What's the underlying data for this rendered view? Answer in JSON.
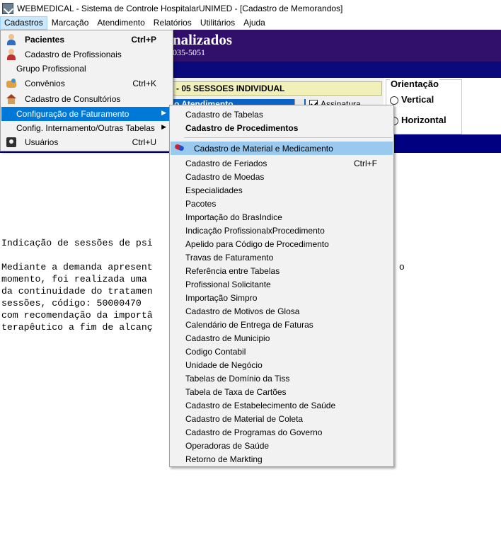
{
  "window": {
    "title": "WEBMEDICAL - Sistema de Controle HospitalarUNIMED - [Cadastro de Memorandos]"
  },
  "menubar": {
    "items": [
      "Cadastros",
      "Marcação",
      "Atendimento",
      "Relatórios",
      "Utilitários",
      "Ajuda"
    ]
  },
  "background": {
    "header_title": "nalizados",
    "header_phone": "035-5051",
    "sessions_field": "- 05 SESSOES INDIVIDUAL",
    "combo_value": "o Atendimento",
    "checkbox_label": "Assinatura",
    "orientation": {
      "title": "Orientação",
      "options": [
        "Vertical",
        "Horizontal"
      ]
    },
    "memo_lines": [
      "Indicação de sessões de psi",
      "Mediante a demanda apresent                              coterapia até o",
      "momento, foi realizada uma                             o a necessidade",
      "da continuidade do tratamen                             o de 5 (cinco)",
      "sessões, código: 50000470                              OR PSICOLOGO)",
      "com recomendação da importâ                           acompanhamento",
      "terapêutico a fim de alcanç"
    ]
  },
  "cadastros_menu": {
    "items": [
      {
        "label": "Pacientes",
        "shortcut": "Ctrl+P",
        "icon": "patient-icon"
      },
      {
        "label": "Cadastro de Profissionais",
        "shortcut": "",
        "icon": "doctor-icon"
      },
      {
        "label": "Grupo Profissional",
        "shortcut": ""
      },
      {
        "label": "Convênios",
        "shortcut": "Ctrl+K",
        "icon": "handshake-icon"
      },
      {
        "label": "Cadastro de Consultórios",
        "shortcut": "",
        "icon": "office-icon"
      },
      {
        "label": "Configuração de Faturamento",
        "shortcut": "",
        "submenu": true
      },
      {
        "label": "Config. Internamento/Outras Tabelas",
        "shortcut": "",
        "submenu": true
      },
      {
        "label": "Usuários",
        "shortcut": "Ctrl+U",
        "icon": "users-icon"
      }
    ]
  },
  "faturamento_submenu": {
    "items": [
      {
        "label": "Cadastro de Tabelas"
      },
      {
        "label": "Cadastro de Procedimentos"
      },
      {
        "label": "Cadastro de Material e Medicamento",
        "icon": "pill-icon"
      },
      {
        "label": "Cadastro de Feriados",
        "shortcut": "Ctrl+F"
      },
      {
        "label": "Cadastro de Moedas"
      },
      {
        "label": "Especialidades"
      },
      {
        "label": "Pacotes"
      },
      {
        "label": "Importação do BrasIndice"
      },
      {
        "label": "Indicação ProfissionalxProcedimento"
      },
      {
        "label": "Apelido para Código de Procedimento"
      },
      {
        "label": "Travas de Faturamento"
      },
      {
        "label": "Referência entre Tabelas"
      },
      {
        "label": "Profissional Solicitante"
      },
      {
        "label": "Importação Simpro"
      },
      {
        "label": "Cadastro de Motivos de Glosa"
      },
      {
        "label": "Calendário de Entrega de Faturas"
      },
      {
        "label": "Cadastro de Municipio"
      },
      {
        "label": "Codigo Contabil"
      },
      {
        "label": "Unidade de Negócio"
      },
      {
        "label": "Tabelas de Domínio da Tiss"
      },
      {
        "label": "Tabela de Taxa de Cartões"
      },
      {
        "label": "Cadastro de Estabelecimento de Saúde"
      },
      {
        "label": "Cadastro de Material de Coleta"
      },
      {
        "label": "Cadastro de Programas do Governo"
      },
      {
        "label": "Operadoras de Saúde"
      },
      {
        "label": "Retorno de Markting"
      }
    ]
  }
}
